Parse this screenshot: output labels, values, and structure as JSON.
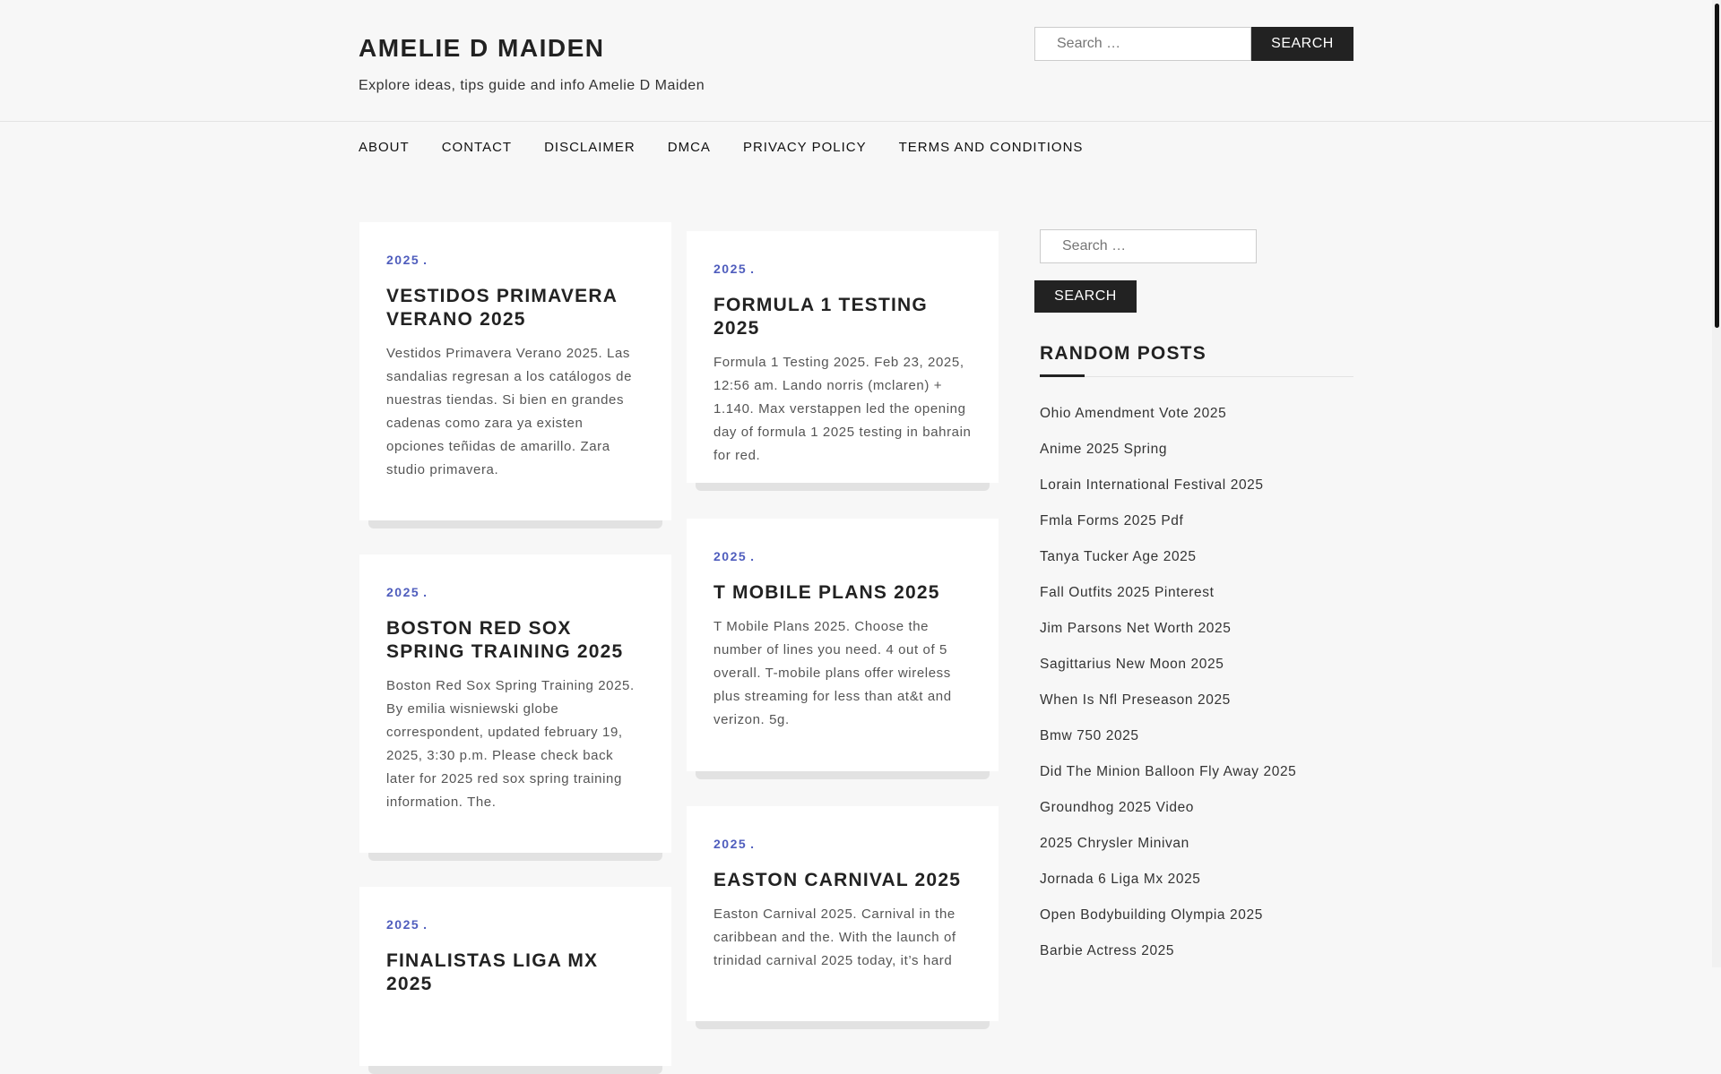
{
  "site": {
    "title": "AMELIE D MAIDEN",
    "description": "Explore ideas, tips guide and info Amelie D Maiden"
  },
  "header_search": {
    "placeholder": "Search …",
    "button": "Search"
  },
  "nav": {
    "items": [
      "ABOUT",
      "CONTACT",
      "DISCLAIMER",
      "DMCA",
      "PRIVACY POLICY",
      "TERMS AND CONDITIONS"
    ]
  },
  "posts": [
    {
      "category": "2025",
      "title": "Vestidos Primavera Verano 2025",
      "excerpt": "Vestidos Primavera Verano 2025. Las sandalias regresan a los catálogos de nuestras tiendas. Si bien en grandes cadenas como zara ya existen opciones teñidas de amarillo. Zara studio primavera."
    },
    {
      "category": "2025",
      "title": "Formula 1 Testing 2025",
      "excerpt": "Formula 1 Testing 2025. Feb 23, 2025, 12:56 am. Lando norris (mclaren) + 1.140. Max verstappen led the opening day of formula 1 2025 testing in bahrain for red."
    },
    {
      "category": "2025",
      "title": "Boston Red Sox Spring Training 2025",
      "excerpt": "Boston Red Sox Spring Training 2025. By emilia wisniewski globe correspondent, updated february 19, 2025, 3:30 p.m. Please check back later for 2025 red sox spring training information. The."
    },
    {
      "category": "2025",
      "title": "T Mobile Plans 2025",
      "excerpt": "T Mobile Plans 2025. Choose the number of lines you need. 4 out of 5 overall. T-mobile plans offer wireless plus streaming for less than at&t and verizon. 5g."
    },
    {
      "category": "2025",
      "title": "Finalistas Liga Mx 2025",
      "excerpt": ""
    },
    {
      "category": "2025",
      "title": "Easton Carnival 2025",
      "excerpt": "Easton Carnival 2025. Carnival in the caribbean and the. With the launch of trinidad carnival 2025 today, it’s hard"
    }
  ],
  "sidebar": {
    "search_placeholder": "Search …",
    "search_button": "Search",
    "random_heading": "RANDOM POSTS",
    "random_posts": [
      "Ohio Amendment Vote 2025",
      "Anime 2025 Spring",
      "Lorain International Festival 2025",
      "Fmla Forms 2025 Pdf",
      "Tanya Tucker Age 2025",
      "Fall Outfits 2025 Pinterest",
      "Jim Parsons Net Worth 2025",
      "Sagittarius New Moon 2025",
      "When Is Nfl Preseason 2025",
      "Bmw 750 2025",
      "Did The Minion Balloon Fly Away 2025",
      "Groundhog 2025 Video",
      "2025 Chrysler Minivan",
      "Jornada 6 Liga Mx 2025",
      "Open Bodybuilding Olympia 2025",
      "Barbie Actress 2025"
    ]
  },
  "colors": {
    "accent": "#4f5dbd",
    "button": "#222222",
    "background": "#f7f7f7"
  }
}
